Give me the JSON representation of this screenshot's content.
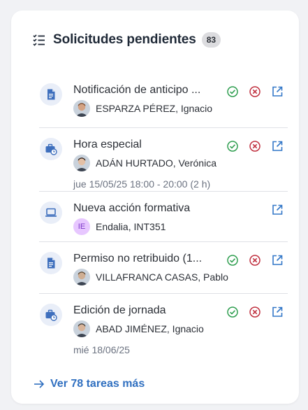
{
  "widget": {
    "title": "Solicitudes pendientes",
    "count": "83",
    "title_icon": "checklist-icon",
    "more_link": "Ver 78 tareas más",
    "more_icon": "arrow-right-icon"
  },
  "colors": {
    "approve": "#2e9e4f",
    "reject": "#c0303f",
    "open": "#3478c8",
    "type_icon_bg": "#e9eef8",
    "type_icon_fg": "#3e6fbd"
  },
  "requests": [
    {
      "type_icon": "document-icon",
      "title": "Notificación de anticipo ...",
      "user": "ESPARZA PÉREZ, Ignacio",
      "date": "",
      "avatar": "photo",
      "actions": [
        "approve",
        "reject",
        "open"
      ]
    },
    {
      "type_icon": "briefcase-clock-icon",
      "title": "Hora especial",
      "user": "ADÁN HURTADO, Verónica",
      "date": "jue 15/05/25 18:00 - 20:00 (2 h)",
      "avatar": "photo",
      "actions": [
        "approve",
        "reject",
        "open"
      ]
    },
    {
      "type_icon": "laptop-icon",
      "title": "Nueva acción formativa",
      "user": "Endalia, INT351",
      "date": "",
      "avatar": "initials",
      "initials": "IE",
      "actions": [
        "open"
      ]
    },
    {
      "type_icon": "document-icon",
      "title": "Permiso no retribuido (1...",
      "user": "VILLAFRANCA CASAS, Pablo",
      "date": "",
      "avatar": "photo",
      "actions": [
        "approve",
        "reject",
        "open"
      ]
    },
    {
      "type_icon": "briefcase-clock-icon",
      "title": "Edición de jornada",
      "user": "ABAD JIMÉNEZ, Ignacio",
      "date": "mié 18/06/25",
      "avatar": "photo",
      "actions": [
        "approve",
        "reject",
        "open"
      ]
    }
  ]
}
